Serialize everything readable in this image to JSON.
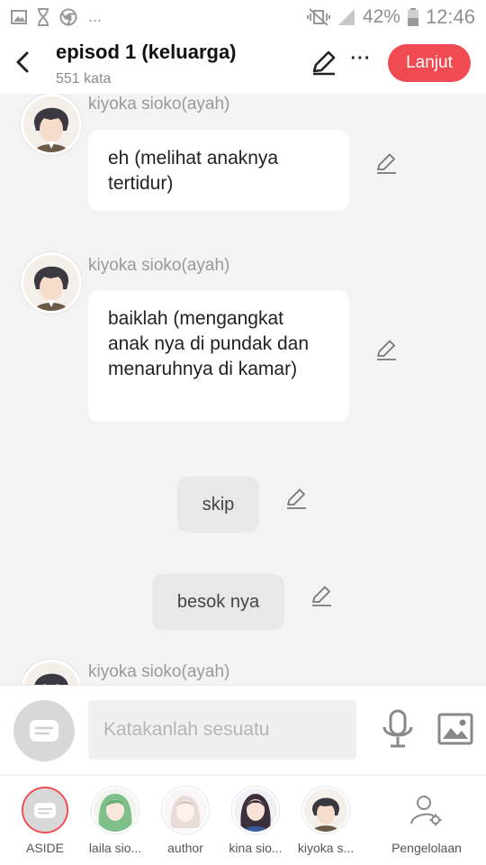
{
  "status_bar": {
    "left_icons": [
      "gallery-icon",
      "hourglass-icon",
      "chrome-icon"
    ],
    "overflow": "...",
    "battery": "42%",
    "time": "12:46"
  },
  "header": {
    "back_icon": "chevron-left-icon",
    "title": "episod 1 (keluarga)",
    "subtitle": "551 kata",
    "edit_icon": "pencil-icon",
    "more_label": "···",
    "next_label": "Lanjut"
  },
  "messages": [
    {
      "type": "character",
      "name": "kiyoka sioko(ayah)",
      "text": "eh (melihat anaknya tertidur)"
    },
    {
      "type": "character",
      "name": "kiyoka sioko(ayah)",
      "text": "baiklah (mengangkat anak nya di pundak dan menaruhnya di kamar)"
    },
    {
      "type": "narration",
      "text": "skip"
    },
    {
      "type": "narration",
      "text": "besok nya"
    },
    {
      "type": "character",
      "name": "kiyoka sioko(ayah)",
      "text": ""
    }
  ],
  "input": {
    "placeholder": "Katakanlah sesuatu",
    "mic_icon": "microphone-icon",
    "image_icon": "image-icon"
  },
  "characters": [
    {
      "label": "ASIDE",
      "selected": true
    },
    {
      "label": "laila sio..."
    },
    {
      "label": "author"
    },
    {
      "label": "kina sio..."
    },
    {
      "label": "kiyoka s..."
    },
    {
      "label": "Pengelolaan",
      "icon": "user-settings-icon"
    }
  ],
  "colors": {
    "accent": "#f04a53",
    "background": "#f3f3f3",
    "bubble": "#ffffff",
    "narration_pill": "#e8e8e8"
  }
}
